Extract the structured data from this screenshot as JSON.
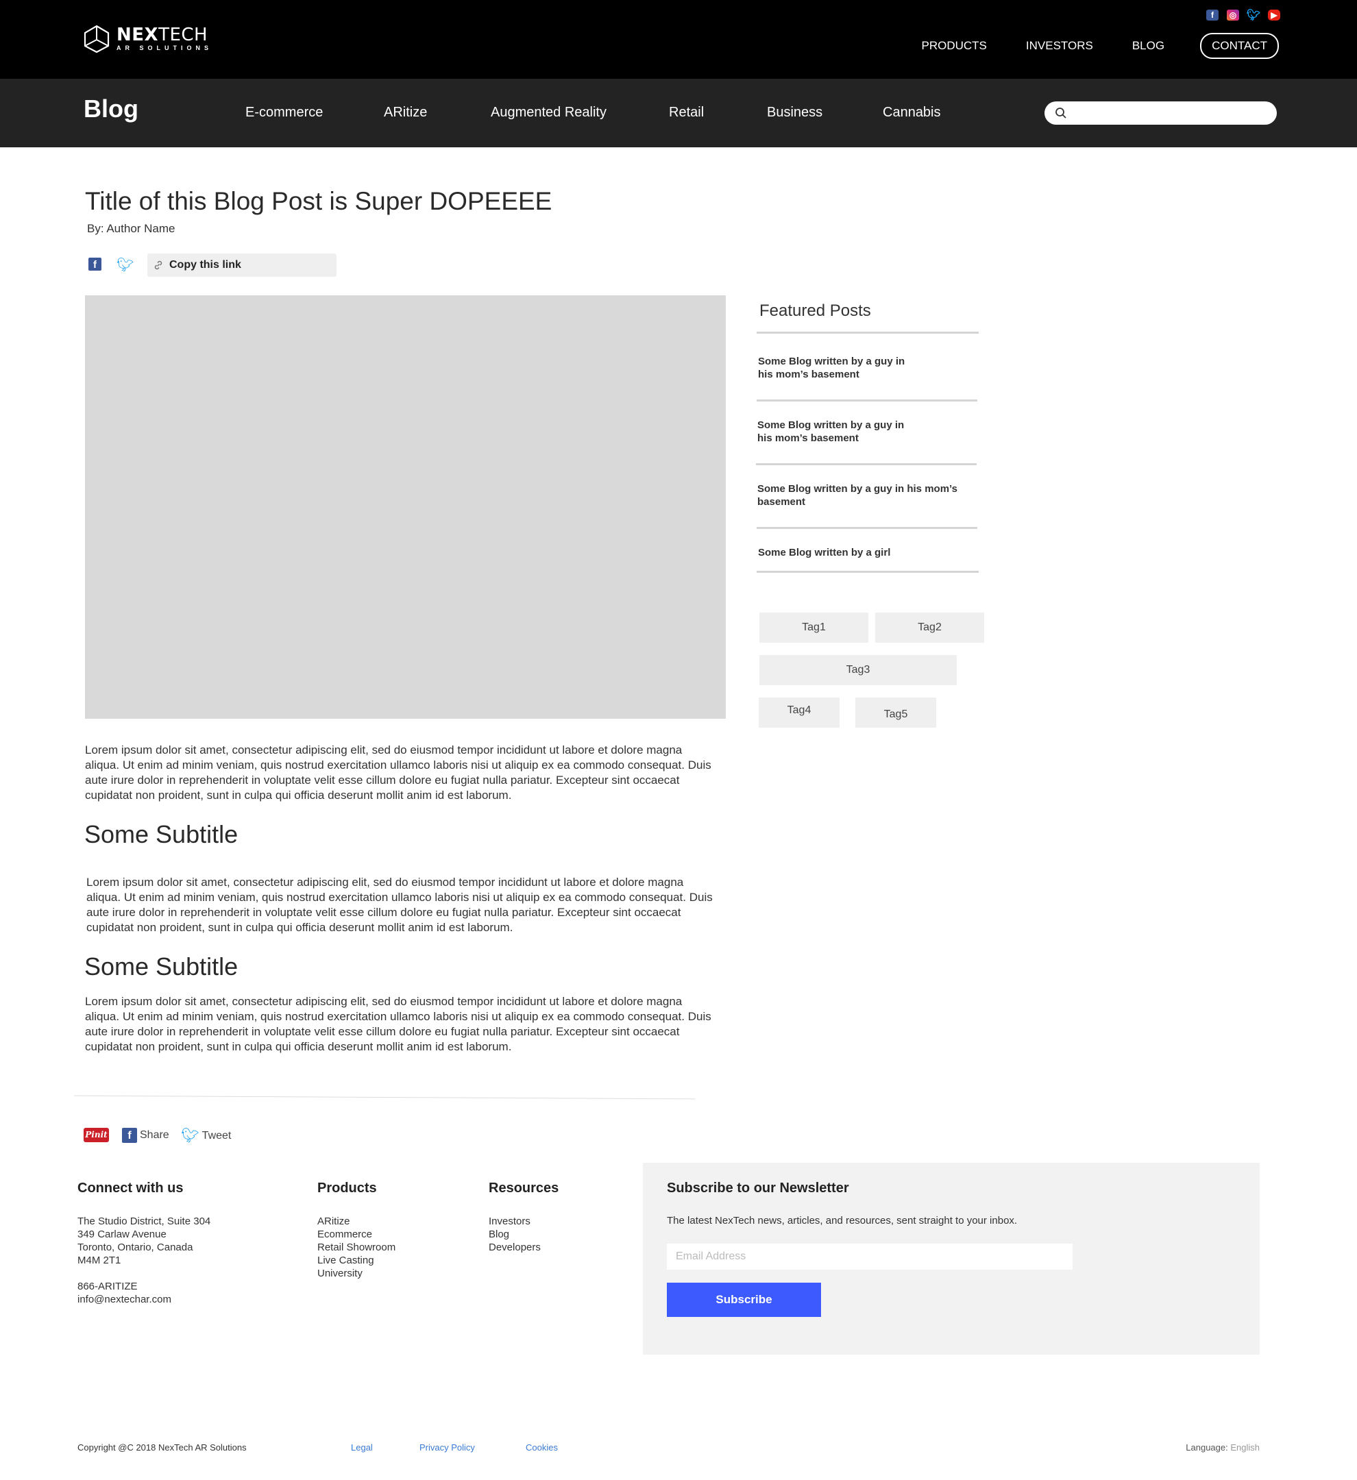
{
  "header": {
    "brand": "NEXTECH",
    "brand_sub": "AR SOLUTIONS",
    "social": [
      "facebook-icon",
      "instagram-icon",
      "twitter-icon",
      "youtube-icon"
    ],
    "nav": {
      "products": "PRODUCTS",
      "investors": "INVESTORS",
      "blog": "BLOG",
      "contact": "CONTACT"
    }
  },
  "blog_nav": {
    "title": "Blog",
    "categories": [
      "E-commerce",
      "ARitize",
      "Augmented Reality",
      "Retail",
      "Business",
      "Cannabis"
    ],
    "search_placeholder": ""
  },
  "article": {
    "title": "Title of this Blog Post is Super DOPEEEE",
    "author": "By: Author Name",
    "copy_link": "Copy this link",
    "paragraphs": [
      "Lorem ipsum dolor sit amet, consectetur adipiscing elit, sed do eiusmod tempor incididunt ut labore et dolore magna aliqua. Ut enim ad minim veniam, quis nostrud exercitation ullamco laboris nisi ut aliquip ex ea commodo consequat. Duis aute irure dolor in reprehenderit in voluptate velit esse cillum dolore eu fugiat nulla pariatur. Excepteur sint occaecat cupidatat non proident, sunt in culpa qui officia deserunt mollit anim id est laborum.",
      "Lorem ipsum dolor sit amet, consectetur adipiscing elit, sed do eiusmod tempor incididunt ut labore et dolore magna aliqua. Ut enim ad minim veniam, quis nostrud exercitation ullamco laboris nisi ut aliquip ex ea commodo consequat. Duis aute irure dolor in reprehenderit in voluptate velit esse cillum dolore eu fugiat nulla pariatur. Excepteur sint occaecat cupidatat non proident, sunt in culpa qui officia deserunt mollit anim id est laborum.",
      "Lorem ipsum dolor sit amet, consectetur adipiscing elit, sed do eiusmod tempor incididunt ut labore et dolore magna aliqua. Ut enim ad minim veniam, quis nostrud exercitation ullamco laboris nisi ut aliquip ex ea commodo consequat. Duis aute irure dolor in reprehenderit in voluptate velit esse cillum dolore eu fugiat nulla pariatur. Excepteur sint occaecat cupidatat non proident, sunt in culpa qui officia deserunt mollit anim id est laborum."
    ],
    "subtitles": [
      "Some Subtitle",
      "Some Subtitle"
    ]
  },
  "sidebar": {
    "featured_title": "Featured Posts",
    "featured": [
      "Some Blog written by a guy in his mom’s basement",
      "Some Blog written by a guy in his mom’s basement",
      "Some Blog written by a guy in his mom’s basement",
      "Some Blog written by a girl"
    ],
    "tags": [
      "Tag1",
      "Tag2",
      "Tag3",
      "Tag4",
      "Tag5"
    ]
  },
  "share_row": {
    "pinit": "Pinit",
    "share": "Share",
    "tweet": "Tweet"
  },
  "footer": {
    "connect": {
      "title": "Connect with us",
      "lines": [
        "The Studio District, Suite 304",
        "349 Carlaw Avenue",
        "Toronto, Ontario, Canada",
        "M4M 2T1"
      ],
      "phone": "866-ARITIZE",
      "email": "info@nextechar.com"
    },
    "products": {
      "title": "Products",
      "items": [
        "ARitize",
        "Ecommerce",
        "Retail Showroom",
        "Live Casting",
        "University"
      ]
    },
    "resources": {
      "title": "Resources",
      "items": [
        "Investors",
        "Blog",
        "Developers"
      ]
    },
    "newsletter": {
      "title": "Subscribe to our Newsletter",
      "description": "The latest NexTech news, articles, and resources, sent straight to your inbox.",
      "email_placeholder": "Email Address",
      "button": "Subscribe"
    },
    "copyright": "Copyright @C 2018 NexTech AR Solutions",
    "legal": "Legal",
    "privacy": "Privacy Policy",
    "cookies": "Cookies",
    "language_label": "Language:",
    "language_value": "English"
  },
  "colors": {
    "header_bg": "#000000",
    "blog_nav_bg": "#232323",
    "accent_button": "#3d5afe",
    "link": "#3a7bd5",
    "hero_placeholder": "#d9d9d9"
  }
}
